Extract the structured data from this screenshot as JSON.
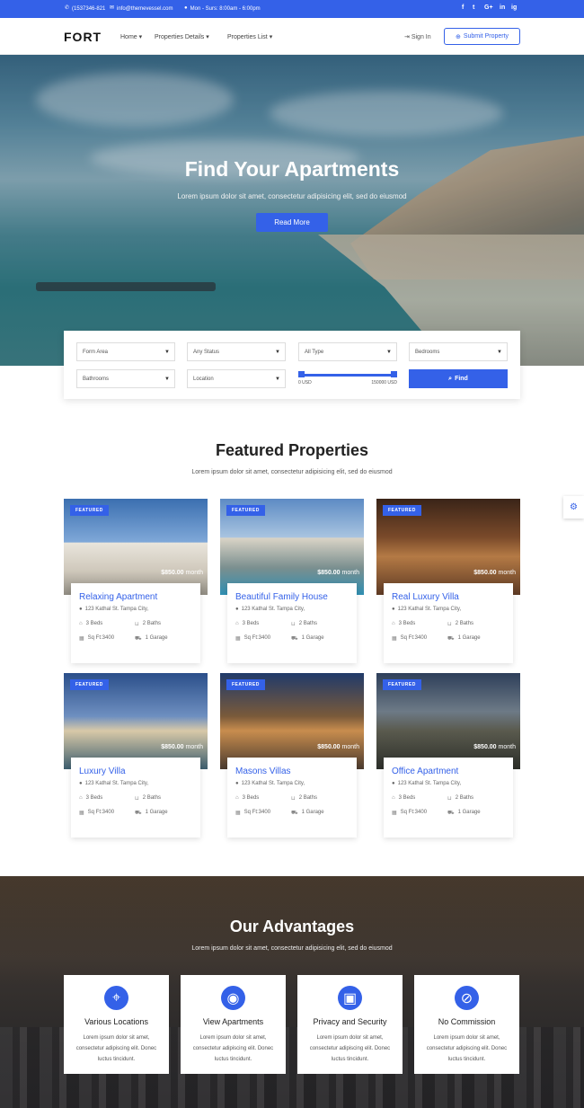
{
  "topbar": {
    "phone": "(1537346-821",
    "email": "info@themevessel.com",
    "hours": "Mon - Surs: 8:00am - 6:00pm",
    "social": [
      "f",
      "t",
      "G+",
      "in",
      "ig"
    ]
  },
  "nav": {
    "logo": "FORT",
    "menu": [
      "Home",
      "Properties Details",
      "Properties List"
    ],
    "signin": "Sign In",
    "submit": "Submit Property"
  },
  "hero": {
    "title": "Find Your Apartments",
    "subtitle": "Lorem ipsum dolor sit amet, consectetur adipisicing elit, sed do eiusmod",
    "button": "Read More"
  },
  "search": {
    "fields": [
      "Form Area",
      "Any Status",
      "All Type",
      "Bedrooms",
      "Bathrooms",
      "Location"
    ],
    "price_min": "0 USD",
    "price_max": "150000 USD",
    "find_label": "Find",
    "range_low_fraction": 0.0,
    "range_high_fraction": 1.0
  },
  "featured": {
    "title": "Featured Properties",
    "subtitle": "Lorem ipsum dolor sit amet, consectetur adipisicing elit, sed do eiusmod",
    "badge": "FEATURED",
    "price": "$850.00",
    "per": "month",
    "address": "123 Kathal St. Tampa City,",
    "beds": "3 Beds",
    "baths": "2 Baths",
    "area": "Sq Ft:3400",
    "garage": "1 Garage",
    "cards": [
      {
        "name": "Relaxing Apartment"
      },
      {
        "name": "Beautiful Family House"
      },
      {
        "name": "Real Luxury Villa"
      },
      {
        "name": "Luxury Villa"
      },
      {
        "name": "Masons Villas"
      },
      {
        "name": "Office Apartment"
      }
    ]
  },
  "advantages": {
    "title": "Our Advantages",
    "subtitle": "Lorem ipsum dolor sit amet, consectetur adipisicing elit, sed do eiusmod",
    "desc": "Lorem ipsum dolor sit amet, consectetur adipiscing elit. Donec luctus tincidunt.",
    "items": [
      {
        "title": "Various Locations",
        "icon": "location-pin-icon"
      },
      {
        "title": "View Apartments",
        "icon": "camera-icon"
      },
      {
        "title": "Privacy and Security",
        "icon": "lock-icon"
      },
      {
        "title": "No Commission",
        "icon": "no-commission-icon"
      }
    ]
  },
  "colors": {
    "accent": "#3461e8"
  }
}
